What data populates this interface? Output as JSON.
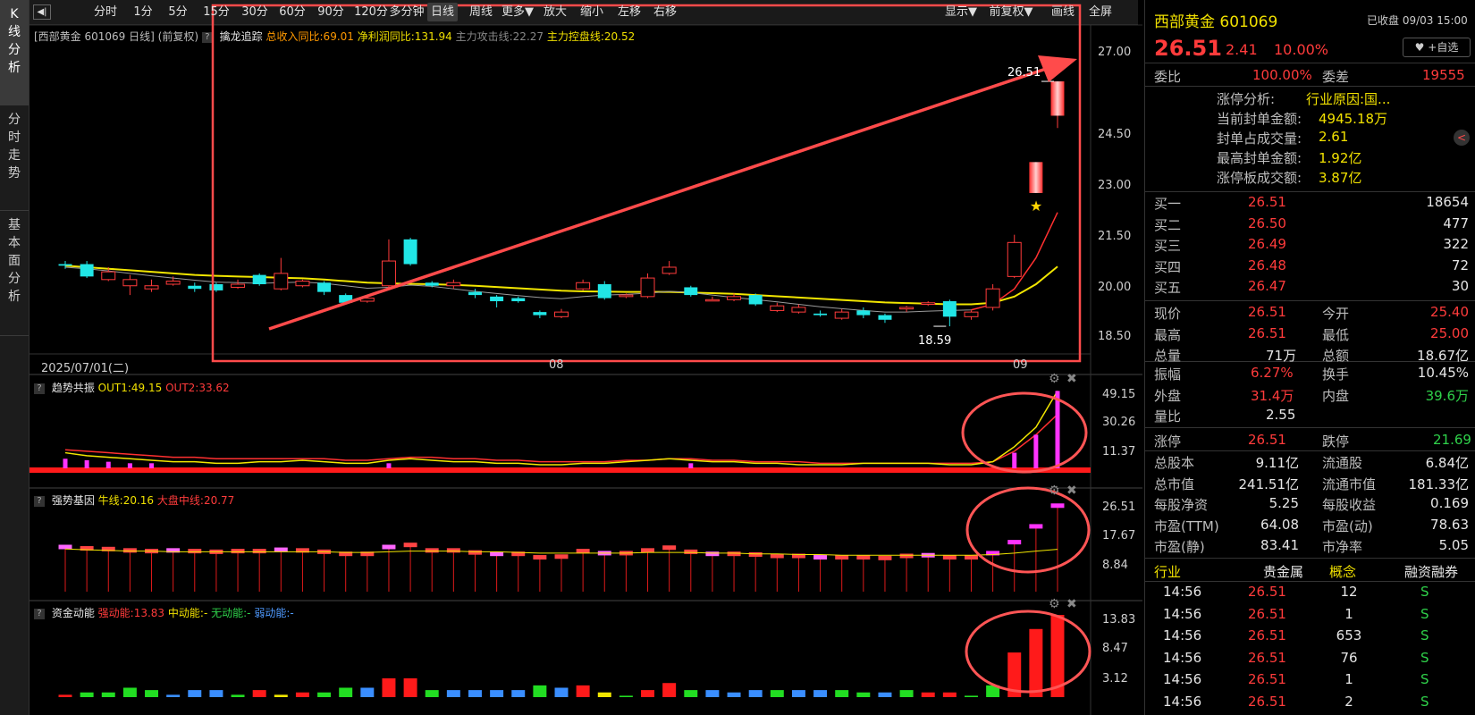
{
  "side_tabs": [
    {
      "label": "K线分析",
      "active": true
    },
    {
      "label": "分时走势",
      "active": false
    },
    {
      "label": "基本面分析",
      "active": false
    }
  ],
  "toolbar": {
    "items": [
      "分时",
      "1分",
      "5分",
      "15分",
      "30分",
      "60分",
      "90分",
      "120分",
      "多分钟",
      "日线",
      "周线",
      "更多▼",
      "放大",
      "缩小",
      "左移",
      "右移"
    ],
    "active": "日线",
    "right_items": [
      "显示▼",
      "前复权▼",
      "画线",
      "全屏"
    ]
  },
  "main_chart": {
    "header_name": "[西部黄金 601069 日线]",
    "header_adj": "(前复权)",
    "indicator_name": "擒龙追踪",
    "ind1": "总收入同比:69.01",
    "ind2": "净利润同比:131.94",
    "ind3": "主力攻击线:22.27",
    "ind4": "主力控盘线:20.52",
    "y_ticks": [
      "27.00",
      "24.50",
      "23.00",
      "21.50",
      "20.00",
      "18.50"
    ],
    "x_labels": [
      "2025/07/01(二)",
      "08",
      "09"
    ],
    "high_label": "26.51",
    "low_label": "18.59",
    "ylim": [
      18.0,
      27.5
    ]
  },
  "panel1": {
    "title": "趋势共振",
    "out1": "OUT1:49.15",
    "out2": "OUT2:33.62",
    "y_ticks": [
      "49.15",
      "30.26",
      "11.37"
    ]
  },
  "panel2": {
    "title": "强势基因",
    "l1": "牛线:20.16",
    "l2": "大盘中线:20.77",
    "y_ticks": [
      "26.51",
      "17.67",
      "8.84"
    ]
  },
  "panel3": {
    "title": "资金动能",
    "l1": "强动能:13.83",
    "l2": "中动能:-",
    "l3": "无动能:-",
    "l4": "弱动能:-",
    "y_ticks": [
      "13.83",
      "8.47",
      "3.12"
    ]
  },
  "chart_data": {
    "type": "candlestick",
    "candles": [
      {
        "o": 20.6,
        "c": 20.55,
        "h": 20.7,
        "l": 20.45
      },
      {
        "o": 20.6,
        "c": 20.2,
        "h": 20.7,
        "l": 20.15
      },
      {
        "o": 20.1,
        "c": 20.35,
        "h": 20.5,
        "l": 20.05
      },
      {
        "o": 19.9,
        "c": 20.1,
        "h": 20.25,
        "l": 19.6
      },
      {
        "o": 19.8,
        "c": 19.9,
        "h": 20.1,
        "l": 19.7
      },
      {
        "o": 19.95,
        "c": 20.05,
        "h": 20.2,
        "l": 19.9
      },
      {
        "o": 19.9,
        "c": 19.8,
        "h": 20.0,
        "l": 19.7
      },
      {
        "o": 19.95,
        "c": 19.75,
        "h": 20.0,
        "l": 19.7
      },
      {
        "o": 19.85,
        "c": 19.95,
        "h": 20.1,
        "l": 19.8
      },
      {
        "o": 20.25,
        "c": 19.95,
        "h": 20.3,
        "l": 19.9
      },
      {
        "o": 19.8,
        "c": 20.3,
        "h": 20.8,
        "l": 19.75
      },
      {
        "o": 19.9,
        "c": 20.05,
        "h": 20.1,
        "l": 19.85
      },
      {
        "o": 20.0,
        "c": 19.7,
        "h": 20.05,
        "l": 19.6
      },
      {
        "o": 19.6,
        "c": 19.35,
        "h": 19.65,
        "l": 19.3
      },
      {
        "o": 19.4,
        "c": 19.5,
        "h": 19.55,
        "l": 19.35
      },
      {
        "o": 19.9,
        "c": 20.7,
        "h": 21.4,
        "l": 19.85
      },
      {
        "o": 21.4,
        "c": 20.6,
        "h": 21.45,
        "l": 20.55
      },
      {
        "o": 20.0,
        "c": 19.9,
        "h": 20.05,
        "l": 19.85
      },
      {
        "o": 19.9,
        "c": 20.0,
        "h": 20.1,
        "l": 19.8
      },
      {
        "o": 19.7,
        "c": 19.6,
        "h": 19.8,
        "l": 19.5
      },
      {
        "o": 19.55,
        "c": 19.4,
        "h": 19.6,
        "l": 19.2
      },
      {
        "o": 19.5,
        "c": 19.4,
        "h": 19.55,
        "l": 19.35
      },
      {
        "o": 19.05,
        "c": 18.95,
        "h": 19.1,
        "l": 18.85
      },
      {
        "o": 18.9,
        "c": 19.05,
        "h": 19.15,
        "l": 18.85
      },
      {
        "o": 19.8,
        "c": 20.0,
        "h": 20.1,
        "l": 19.75
      },
      {
        "o": 19.95,
        "c": 19.5,
        "h": 20.05,
        "l": 19.45
      },
      {
        "o": 19.55,
        "c": 19.6,
        "h": 19.65,
        "l": 19.5
      },
      {
        "o": 19.55,
        "c": 20.15,
        "h": 20.3,
        "l": 19.5
      },
      {
        "o": 20.3,
        "c": 20.5,
        "h": 20.7,
        "l": 20.25
      },
      {
        "o": 19.85,
        "c": 19.6,
        "h": 19.9,
        "l": 19.55
      },
      {
        "o": 19.45,
        "c": 19.45,
        "h": 19.55,
        "l": 19.4
      },
      {
        "o": 19.45,
        "c": 19.55,
        "h": 19.65,
        "l": 19.4
      },
      {
        "o": 19.6,
        "c": 19.3,
        "h": 19.65,
        "l": 19.25
      },
      {
        "o": 19.1,
        "c": 19.25,
        "h": 19.35,
        "l": 19.05
      },
      {
        "o": 19.05,
        "c": 19.2,
        "h": 19.3,
        "l": 19.0
      },
      {
        "o": 19.0,
        "c": 18.95,
        "h": 19.1,
        "l": 18.9
      },
      {
        "o": 18.85,
        "c": 19.05,
        "h": 19.15,
        "l": 18.8
      },
      {
        "o": 19.1,
        "c": 18.95,
        "h": 19.2,
        "l": 18.85
      },
      {
        "o": 18.95,
        "c": 18.8,
        "h": 19.0,
        "l": 18.7
      },
      {
        "o": 19.15,
        "c": 19.2,
        "h": 19.25,
        "l": 19.05
      },
      {
        "o": 19.3,
        "c": 19.35,
        "h": 19.4,
        "l": 19.25
      },
      {
        "o": 19.4,
        "c": 18.9,
        "h": 19.45,
        "l": 18.59
      },
      {
        "o": 18.9,
        "c": 19.05,
        "h": 19.1,
        "l": 18.8
      },
      {
        "o": 19.2,
        "c": 19.8,
        "h": 19.95,
        "l": 19.1
      },
      {
        "o": 20.2,
        "c": 21.3,
        "h": 21.55,
        "l": 20.15
      },
      {
        "o": 22.9,
        "c": 23.9,
        "h": 23.9,
        "l": 22.9
      },
      {
        "o": 25.4,
        "c": 26.51,
        "h": 26.51,
        "l": 25.0
      }
    ],
    "ma_yellow": [
      20.55,
      20.5,
      20.45,
      20.4,
      20.35,
      20.3,
      20.25,
      20.22,
      20.2,
      20.18,
      20.16,
      20.14,
      20.1,
      20.05,
      20.0,
      19.98,
      19.96,
      19.95,
      19.93,
      19.9,
      19.86,
      19.82,
      19.78,
      19.74,
      19.72,
      19.71,
      19.7,
      19.7,
      19.7,
      19.68,
      19.66,
      19.64,
      19.6,
      19.56,
      19.52,
      19.48,
      19.44,
      19.4,
      19.36,
      19.34,
      19.32,
      19.3,
      19.3,
      19.35,
      19.55,
      19.95,
      20.52
    ],
    "ma_gray": [
      20.5,
      20.45,
      20.38,
      20.3,
      20.22,
      20.15,
      20.08,
      20.02,
      20.0,
      19.98,
      20.0,
      20.02,
      19.98,
      19.9,
      19.82,
      19.85,
      19.92,
      19.88,
      19.8,
      19.72,
      19.65,
      19.58,
      19.52,
      19.48,
      19.55,
      19.6,
      19.62,
      19.66,
      19.72,
      19.68,
      19.6,
      19.52,
      19.45,
      19.38,
      19.3,
      19.22,
      19.16,
      19.1,
      19.05,
      19.05,
      19.08,
      19.1,
      19.12,
      19.3,
      19.8,
      20.8,
      22.27
    ],
    "x_start_label": "2025/07/01(二)",
    "x_month_labels": [
      "08",
      "09"
    ],
    "panel1_bars": [
      4,
      3,
      2,
      1,
      1,
      0,
      0,
      0,
      0,
      0,
      0,
      0,
      0,
      0,
      0,
      1,
      0,
      0,
      0,
      0,
      0,
      0,
      0,
      0,
      0,
      0,
      0,
      0,
      0,
      1,
      0,
      0,
      0,
      0,
      0,
      0,
      0,
      0,
      0,
      0,
      0,
      0,
      0,
      0,
      8,
      20,
      49.15
    ],
    "panel1_out1": [
      8,
      6,
      5,
      4,
      3,
      2,
      2,
      1,
      1,
      2,
      2,
      3,
      2,
      1,
      1,
      3,
      4,
      3,
      2,
      2,
      1,
      1,
      0,
      0,
      1,
      1,
      2,
      3,
      4,
      3,
      2,
      2,
      1,
      1,
      0,
      0,
      0,
      1,
      1,
      1,
      1,
      0,
      0,
      2,
      12,
      25,
      49.15
    ],
    "panel1_out2": [
      10,
      9,
      8,
      7,
      6,
      5,
      5,
      4,
      4,
      4,
      4,
      4,
      4,
      3,
      3,
      4,
      5,
      5,
      4,
      4,
      3,
      3,
      2,
      2,
      2,
      2,
      3,
      3,
      4,
      4,
      3,
      3,
      2,
      2,
      2,
      1,
      1,
      1,
      1,
      1,
      1,
      1,
      1,
      2,
      9,
      20,
      33.62
    ],
    "panel2_values": [
      20.5,
      20.3,
      20.2,
      20.0,
      19.9,
      20.0,
      19.9,
      19.8,
      19.9,
      19.9,
      20.1,
      20.0,
      19.8,
      19.5,
      19.5,
      20.5,
      20.8,
      20.0,
      20.0,
      19.7,
      19.5,
      19.5,
      19.0,
      19.1,
      19.9,
      19.6,
      19.6,
      20.0,
      20.4,
      19.8,
      19.5,
      19.5,
      19.4,
      19.2,
      19.2,
      19.0,
      19.0,
      19.0,
      18.9,
      19.2,
      19.3,
      19.0,
      19.0,
      19.6,
      21.2,
      23.5,
      26.51
    ],
    "panel2_line": [
      20.2,
      20.1,
      20.0,
      19.9,
      19.9,
      19.8,
      19.8,
      19.8,
      19.8,
      19.8,
      19.8,
      19.8,
      19.8,
      19.7,
      19.7,
      19.8,
      19.9,
      19.9,
      19.9,
      19.8,
      19.8,
      19.7,
      19.6,
      19.6,
      19.6,
      19.6,
      19.6,
      19.7,
      19.7,
      19.7,
      19.6,
      19.6,
      19.5,
      19.5,
      19.4,
      19.4,
      19.3,
      19.3,
      19.3,
      19.3,
      19.3,
      19.3,
      19.3,
      19.4,
      19.6,
      19.9,
      20.16
    ],
    "panel3_values": [
      0.5,
      1.0,
      1.0,
      2.0,
      1.5,
      0.5,
      1.5,
      1.5,
      0.5,
      1.5,
      0.5,
      1.0,
      1.0,
      2.0,
      2.0,
      4.0,
      4.0,
      1.5,
      1.5,
      1.5,
      1.5,
      1.5,
      2.5,
      2.0,
      2.5,
      1.0,
      0.3,
      1.5,
      3.0,
      1.5,
      1.5,
      1.0,
      1.5,
      1.5,
      1.5,
      1.5,
      1.5,
      1.0,
      1.0,
      1.5,
      1.0,
      1.0,
      0.3,
      2.5,
      9.5,
      14.5,
      17.5
    ],
    "panel3_colors": [
      "red",
      "green",
      "green",
      "green",
      "green",
      "blue",
      "blue",
      "blue",
      "green",
      "red",
      "yellow",
      "red",
      "green",
      "green",
      "blue",
      "red",
      "red",
      "green",
      "blue",
      "blue",
      "blue",
      "blue",
      "green",
      "blue",
      "red",
      "yellow",
      "green",
      "red",
      "red",
      "green",
      "blue",
      "blue",
      "blue",
      "green",
      "blue",
      "blue",
      "green",
      "green",
      "blue",
      "green",
      "red",
      "red",
      "green",
      "green",
      "red",
      "red",
      "red"
    ]
  },
  "annotation": {
    "colors": {
      "frame": "#ff4b4b",
      "arrow": "#ff4b4b"
    }
  },
  "right_panel": {
    "stock_name": "西部黄金",
    "stock_code": "601069",
    "status": "已收盘 09/03 15:00",
    "price": "26.51",
    "change": "2.41",
    "change_pct": "10.00%",
    "watch_label": "+自选",
    "weibi_label": "委比",
    "weibi_value": "100.00%",
    "weicha_label": "委差",
    "weicha_value": "19555",
    "limit_analysis": [
      {
        "label": "涨停分析:",
        "value": "行业原因:国..."
      },
      {
        "label": "当前封单金额:",
        "value": "4945.18万"
      },
      {
        "label": "封单占成交量:",
        "value": "2.61"
      },
      {
        "label": "最高封单金额:",
        "value": "1.92亿"
      },
      {
        "label": "涨停板成交额:",
        "value": "3.87亿"
      }
    ],
    "bids": [
      {
        "label": "买一",
        "price": "26.51",
        "vol": "18654"
      },
      {
        "label": "买二",
        "price": "26.50",
        "vol": "477"
      },
      {
        "label": "买三",
        "price": "26.49",
        "vol": "322"
      },
      {
        "label": "买四",
        "price": "26.48",
        "vol": "72"
      },
      {
        "label": "买五",
        "price": "26.47",
        "vol": "30"
      }
    ],
    "quotes": [
      {
        "l1": "现价",
        "v1": "26.51",
        "c1": "red",
        "l2": "今开",
        "v2": "25.40",
        "c2": "red"
      },
      {
        "l1": "最高",
        "v1": "26.51",
        "c1": "red",
        "l2": "最低",
        "v2": "25.00",
        "c2": "red"
      },
      {
        "l1": "总量",
        "v1": "71万",
        "c1": "wht",
        "l2": "总额",
        "v2": "18.67亿",
        "c2": "wht"
      }
    ],
    "quotes2": [
      {
        "l1": "振幅",
        "v1": "6.27%",
        "c1": "red",
        "l2": "换手",
        "v2": "10.45%",
        "c2": "wht"
      },
      {
        "l1": "外盘",
        "v1": "31.4万",
        "c1": "red",
        "l2": "内盘",
        "v2": "39.6万",
        "c2": "grn"
      },
      {
        "l1": "量比",
        "v1": "2.55",
        "c1": "wht",
        "l2": "",
        "v2": "",
        "c2": "wht"
      }
    ],
    "limits": {
      "l1": "涨停",
      "v1": "26.51",
      "l2": "跌停",
      "v2": "21.69"
    },
    "fundamentals": [
      {
        "l1": "总股本",
        "v1": "9.11亿",
        "l2": "流通股",
        "v2": "6.84亿"
      },
      {
        "l1": "总市值",
        "v1": "241.51亿",
        "l2": "流通市值",
        "v2": "181.33亿"
      },
      {
        "l1": "每股净资",
        "v1": "5.25",
        "l2": "每股收益",
        "v2": "0.169"
      },
      {
        "l1": "市盈(TTM)",
        "v1": "64.08",
        "l2": "市盈(动)",
        "v2": "78.63"
      },
      {
        "l1": "市盈(静)",
        "v1": "83.41",
        "l2": "市净率",
        "v2": "5.05"
      }
    ],
    "tabs": {
      "industry": "行业",
      "industry_val": "贵金属",
      "concept": "概念",
      "margin": "融资融券"
    },
    "trades": [
      {
        "time": "14:56",
        "price": "26.51",
        "vol": "12",
        "side": "S"
      },
      {
        "time": "14:56",
        "price": "26.51",
        "vol": "1",
        "side": "S"
      },
      {
        "time": "14:56",
        "price": "26.51",
        "vol": "653",
        "side": "S"
      },
      {
        "time": "14:56",
        "price": "26.51",
        "vol": "76",
        "side": "S"
      },
      {
        "time": "14:56",
        "price": "26.51",
        "vol": "1",
        "side": "S"
      },
      {
        "time": "14:56",
        "price": "26.51",
        "vol": "2",
        "side": "S"
      }
    ]
  }
}
